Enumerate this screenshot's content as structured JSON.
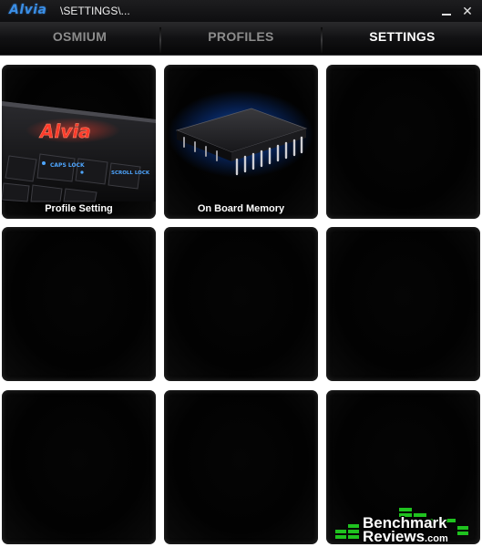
{
  "titlebar": {
    "logo": "Alvia",
    "path": "\\SETTINGS\\...",
    "minimize_label": "",
    "close_label": "✕"
  },
  "tabs": [
    {
      "label": "OSMIUM",
      "active": false
    },
    {
      "label": "PROFILES",
      "active": false
    },
    {
      "label": "SETTINGS",
      "active": true
    }
  ],
  "tiles": [
    {
      "label": "Profile Setting",
      "icon": "keyboard-icon"
    },
    {
      "label": "On Board Memory",
      "icon": "memory-chip-icon"
    },
    {
      "label": "",
      "icon": ""
    },
    {
      "label": "",
      "icon": ""
    },
    {
      "label": "",
      "icon": ""
    },
    {
      "label": "",
      "icon": ""
    },
    {
      "label": "",
      "icon": ""
    },
    {
      "label": "",
      "icon": ""
    },
    {
      "label": "",
      "icon": ""
    }
  ],
  "keyboard_art": {
    "logo": "Alvia",
    "key1": "CAPS LOCK",
    "key2": "SCROLL LOCK"
  },
  "watermark": {
    "line1": "Benchmark",
    "line2": "Reviews",
    "suffix": ".com"
  },
  "colors": {
    "accent_blue": "#3a8ee6",
    "logo_red": "#e8262a",
    "watermark_green": "#1fc21f",
    "tile_bg": "#030303",
    "active_tab_text": "#ffffff",
    "inactive_tab_text": "#8c8c8c"
  }
}
